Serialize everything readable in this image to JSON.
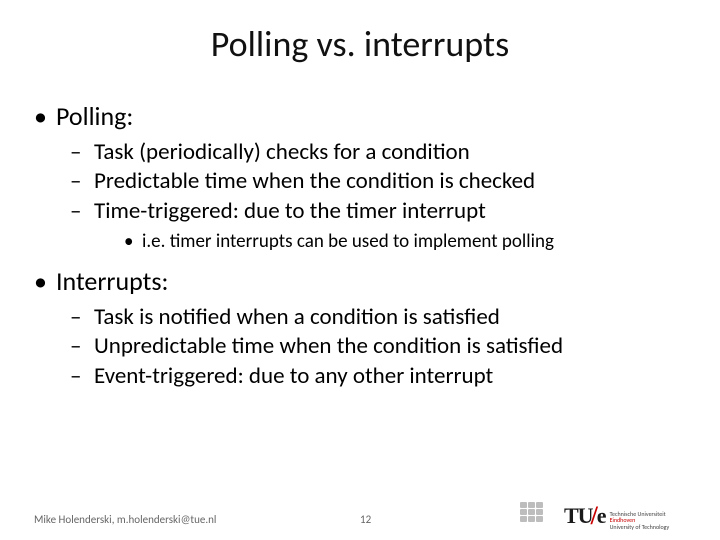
{
  "title": "Polling vs. interrupts",
  "sections": [
    {
      "heading": "Polling:",
      "bullets": [
        "Task (periodically) checks for a condition",
        "Predictable time when the condition is checked",
        "Time-triggered: due to the timer interrupt"
      ],
      "subbullets": [
        "i.e. timer interrupts can be used to implement polling"
      ]
    },
    {
      "heading": "Interrupts:",
      "bullets": [
        "Task is notified when a condition is satisfied",
        "Unpredictable time when the condition is satisfied",
        "Event-triggered: due to any other interrupt"
      ]
    }
  ],
  "footer": {
    "author": "Mike Holenderski, m.holenderski@tue.nl",
    "page": "12",
    "tue_mark_main": "TU",
    "tue_mark_slash": "/",
    "tue_mark_e": "e",
    "tue_line1": "Technische Universiteit",
    "tue_line2_red": "Eindhoven",
    "tue_line3": "University of Technology"
  }
}
